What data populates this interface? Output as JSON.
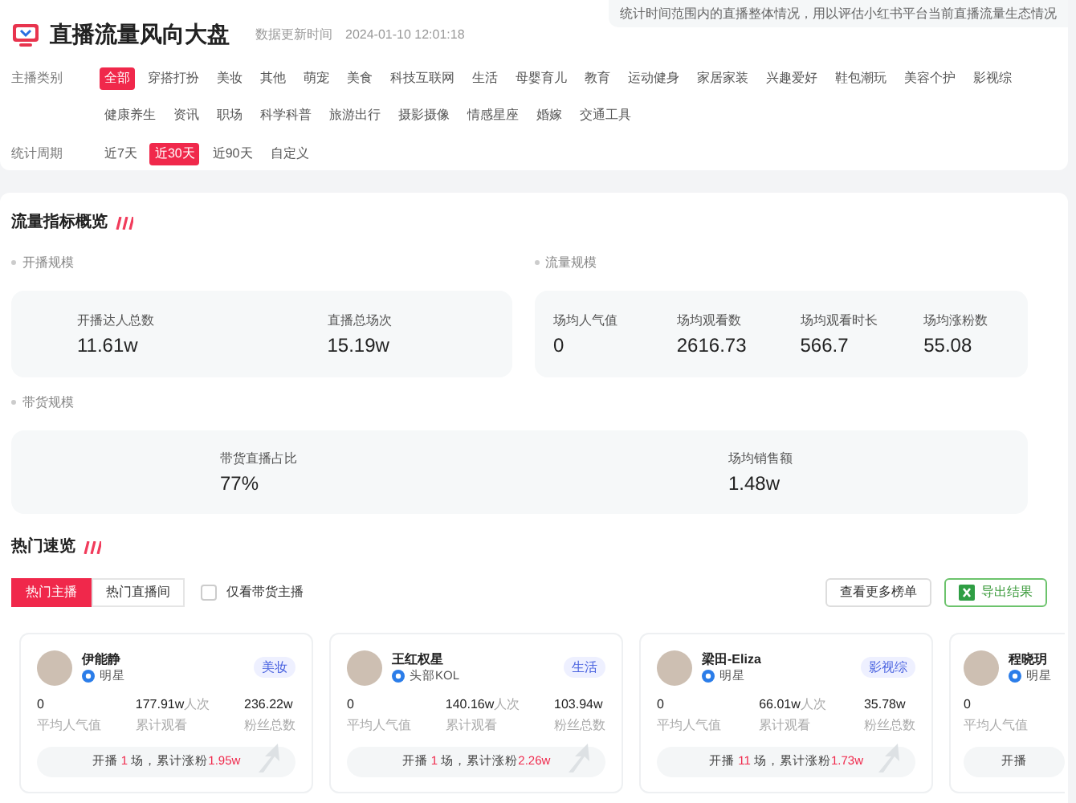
{
  "header": {
    "title": "直播流量风向大盘",
    "update_label": "数据更新时间",
    "update_time": "2024-01-10 12:01:18",
    "note": "统计时间范围内的直播整体情况，用以评估小红书平台当前直播流量生态情况"
  },
  "filters": [
    {
      "label": "主播类别",
      "options": [
        {
          "label": "全部",
          "selected": true
        },
        {
          "label": "穿搭打扮",
          "selected": false
        },
        {
          "label": "美妆",
          "selected": false
        },
        {
          "label": "其他",
          "selected": false
        },
        {
          "label": "萌宠",
          "selected": false
        },
        {
          "label": "美食",
          "selected": false
        },
        {
          "label": "科技互联网",
          "selected": false
        },
        {
          "label": "生活",
          "selected": false
        },
        {
          "label": "母婴育儿",
          "selected": false
        },
        {
          "label": "教育",
          "selected": false
        },
        {
          "label": "运动健身",
          "selected": false
        },
        {
          "label": "家居家装",
          "selected": false
        },
        {
          "label": "兴趣爱好",
          "selected": false
        },
        {
          "label": "鞋包潮玩",
          "selected": false
        },
        {
          "label": "美容个护",
          "selected": false
        },
        {
          "label": "影视综",
          "selected": false
        },
        {
          "label": "健康养生",
          "selected": false
        },
        {
          "label": "资讯",
          "selected": false
        },
        {
          "label": "职场",
          "selected": false
        },
        {
          "label": "科学科普",
          "selected": false
        },
        {
          "label": "旅游出行",
          "selected": false
        },
        {
          "label": "摄影摄像",
          "selected": false
        },
        {
          "label": "情感星座",
          "selected": false
        },
        {
          "label": "婚嫁",
          "selected": false
        },
        {
          "label": "交通工具",
          "selected": false
        }
      ]
    },
    {
      "label": "统计周期",
      "options": [
        {
          "label": "近7天",
          "selected": false
        },
        {
          "label": "近30天",
          "selected": true
        },
        {
          "label": "近90天",
          "selected": false
        },
        {
          "label": "自定义",
          "selected": false
        }
      ]
    }
  ],
  "overview": {
    "title": "流量指标概览",
    "groups": [
      {
        "title": "开播规模",
        "metrics": [
          {
            "label": "开播达人总数",
            "value": "11.61w"
          },
          {
            "label": "直播总场次",
            "value": "15.19w"
          }
        ]
      },
      {
        "title": "流量规模",
        "metrics": [
          {
            "label": "场均人气值",
            "value": "0"
          },
          {
            "label": "场均观看数",
            "value": "2616.73"
          },
          {
            "label": "场均观看时长",
            "value": "566.7"
          },
          {
            "label": "场均涨粉数",
            "value": "55.08"
          }
        ]
      },
      {
        "title": "带货规模",
        "metrics": [
          {
            "label": "带货直播占比",
            "value": "77%"
          },
          {
            "label": "场均销售额",
            "value": "1.48w"
          }
        ]
      }
    ]
  },
  "hot": {
    "title": "热门速览",
    "tabs": [
      {
        "label": "热门主播",
        "selected": true
      },
      {
        "label": "热门直播间",
        "selected": false
      }
    ],
    "filter": {
      "label": "仅看带货主播",
      "checked": false
    },
    "buttons": [
      {
        "label": "查看更多榜单",
        "kind": "plain"
      },
      {
        "label": "导出结果",
        "kind": "export"
      }
    ],
    "cards": [
      {
        "name": "伊能静",
        "role": "明星",
        "category": "美妆",
        "stats": [
          {
            "value": "0",
            "label": "平均人气值"
          },
          {
            "value": "177.91w",
            "unit": "人次",
            "label": "累计观看"
          },
          {
            "value": "236.22w",
            "label": "粉丝总数"
          }
        ],
        "summary": [
          "开播 ",
          "1",
          " 场，累计涨粉",
          "1.95w"
        ]
      },
      {
        "name": "王红权星",
        "role": "头部KOL",
        "category": "生活",
        "stats": [
          {
            "value": "0",
            "label": "平均人气值"
          },
          {
            "value": "140.16w",
            "unit": "人次",
            "label": "累计观看"
          },
          {
            "value": "103.94w",
            "label": "粉丝总数"
          }
        ],
        "summary": [
          "开播 ",
          "1",
          " 场，累计涨粉",
          "2.26w"
        ]
      },
      {
        "name": "梁田-Eliza",
        "role": "明星",
        "category": "影视综",
        "stats": [
          {
            "value": "0",
            "label": "平均人气值"
          },
          {
            "value": "66.01w",
            "unit": "人次",
            "label": "累计观看"
          },
          {
            "value": "35.78w",
            "label": "粉丝总数"
          }
        ],
        "summary": [
          "开播 ",
          "11",
          " 场，累计涨粉",
          "1.73w"
        ]
      },
      {
        "name": "程晓玥",
        "role": "明星",
        "stats": [
          {
            "value": "0",
            "label": "平均人气值"
          }
        ],
        "summary": [
          "开播"
        ]
      }
    ]
  }
}
